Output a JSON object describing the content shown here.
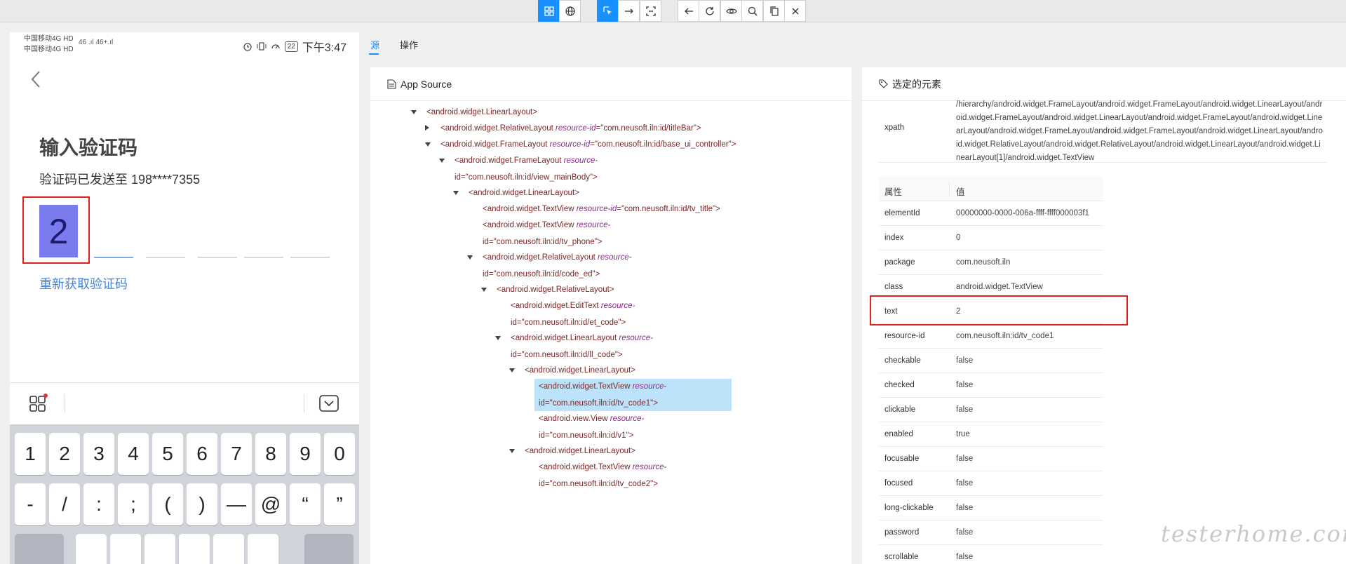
{
  "toolbar": {
    "buttons": [
      {
        "name": "native-app-mode-icon",
        "active": true
      },
      {
        "name": "web-mode-icon",
        "active": false
      },
      {
        "name": "select-elements-icon",
        "active": true
      },
      {
        "name": "swipe-by-coordinates-icon",
        "active": false
      },
      {
        "name": "tap-by-coordinates-icon",
        "active": false
      },
      {
        "name": "back-icon",
        "active": false
      },
      {
        "name": "refresh-icon",
        "active": false
      },
      {
        "name": "eye-icon",
        "active": false
      },
      {
        "name": "search-icon",
        "active": false
      },
      {
        "name": "copy-xml-icon",
        "active": false
      },
      {
        "name": "quit-session-icon",
        "active": false
      }
    ]
  },
  "device": {
    "status": {
      "carrier1": "中国移动4G HD",
      "carrier2": "中国移动4G HD",
      "signal": "46 .ıl 46+.ıl",
      "battery": "22",
      "time": "下午3:47"
    },
    "title": "输入验证码",
    "subtitle": "验证码已发送至 198****7355",
    "code_digit": "2",
    "resend": "重新获取验证码",
    "keyboard_row1": [
      "1",
      "2",
      "3",
      "4",
      "5",
      "6",
      "7",
      "8",
      "9",
      "0"
    ],
    "keyboard_row2": [
      "-",
      "/",
      ":",
      ";",
      "(",
      ")",
      "—",
      "@",
      "“",
      "”"
    ]
  },
  "tabs": [
    {
      "label": "源",
      "active": true
    },
    {
      "label": "操作",
      "active": false
    }
  ],
  "source": {
    "title": "App Source",
    "nodes": [
      {
        "indent": 0,
        "expand": "down",
        "tag": "<android.widget.LinearLayout>",
        "attr": "",
        "val": "",
        "line2": ""
      },
      {
        "indent": 1,
        "expand": "right",
        "tag": "<android.widget.RelativeLayout ",
        "attr": "resource-id",
        "val": "=\"com.neusoft.iln:id/titleBar\">",
        "line2": ""
      },
      {
        "indent": 1,
        "expand": "down",
        "tag": "<android.widget.FrameLayout ",
        "attr": "resource-id",
        "val": "=\"com.neusoft.iln:id/base_ui_controller\">",
        "line2": ""
      },
      {
        "indent": 2,
        "expand": "down",
        "tag": "<android.widget.FrameLayout ",
        "attr": "resource-",
        "val": "",
        "line2": "id=\"com.neusoft.iln:id/view_mainBody\">"
      },
      {
        "indent": 3,
        "expand": "down",
        "tag": "<android.widget.LinearLayout>",
        "attr": "",
        "val": "",
        "line2": ""
      },
      {
        "indent": 4,
        "expand": "",
        "tag": "<android.widget.TextView ",
        "attr": "resource-id",
        "val": "=\"com.neusoft.iln:id/tv_title\">",
        "line2": ""
      },
      {
        "indent": 4,
        "expand": "",
        "tag": "<android.widget.TextView ",
        "attr": "resource-",
        "val": "",
        "line2": "id=\"com.neusoft.iln:id/tv_phone\">"
      },
      {
        "indent": 4,
        "expand": "down",
        "tag": "<android.widget.RelativeLayout ",
        "attr": "resource-",
        "val": "",
        "line2": "id=\"com.neusoft.iln:id/code_ed\">"
      },
      {
        "indent": 5,
        "expand": "down",
        "tag": "<android.widget.RelativeLayout>",
        "attr": "",
        "val": "",
        "line2": ""
      },
      {
        "indent": 6,
        "expand": "",
        "tag": "<android.widget.EditText ",
        "attr": "resource-",
        "val": "",
        "line2": "id=\"com.neusoft.iln:id/et_code\">"
      },
      {
        "indent": 6,
        "expand": "down",
        "tag": "<android.widget.LinearLayout ",
        "attr": "resource-",
        "val": "",
        "line2": "id=\"com.neusoft.iln:id/ll_code\">"
      },
      {
        "indent": 7,
        "expand": "down",
        "tag": "<android.widget.LinearLayout>",
        "attr": "",
        "val": "",
        "line2": ""
      },
      {
        "indent": 8,
        "expand": "",
        "tag": "<android.widget.TextView ",
        "attr": "resource-",
        "val": "",
        "line2": "id=\"com.neusoft.iln:id/tv_code1\">",
        "selected": true
      },
      {
        "indent": 8,
        "expand": "",
        "tag": "<android.view.View ",
        "attr": "resource-",
        "val": "",
        "line2": "id=\"com.neusoft.iln:id/v1\">"
      },
      {
        "indent": 7,
        "expand": "down",
        "tag": "<android.widget.LinearLayout>",
        "attr": "",
        "val": "",
        "line2": ""
      },
      {
        "indent": 8,
        "expand": "",
        "tag": "<android.widget.TextView ",
        "attr": "resource-",
        "val": "",
        "line2": "id=\"com.neusoft.iln:id/tv_code2\">"
      }
    ]
  },
  "selected": {
    "title": "选定的元素",
    "xpath_label": "xpath",
    "xpath_value": "/hierarchy/android.widget.FrameLayout/android.widget.FrameLayout/android.widget.LinearLayout/android.widget.FrameLayout/android.widget.LinearLayout/android.widget.FrameLayout/android.widget.LinearLayout/android.widget.FrameLayout/android.widget.FrameLayout/android.widget.LinearLayout/android.widget.RelativeLayout/android.widget.RelativeLayout/android.widget.LinearLayout/android.widget.LinearLayout[1]/android.widget.TextView",
    "col_attr": "属性",
    "col_value": "值",
    "props": [
      {
        "k": "elementId",
        "v": "00000000-0000-006a-ffff-ffff000003f1"
      },
      {
        "k": "index",
        "v": "0"
      },
      {
        "k": "package",
        "v": "com.neusoft.iln"
      },
      {
        "k": "class",
        "v": "android.widget.TextView"
      },
      {
        "k": "text",
        "v": "2"
      },
      {
        "k": "resource-id",
        "v": "com.neusoft.iln:id/tv_code1"
      },
      {
        "k": "checkable",
        "v": "false"
      },
      {
        "k": "checked",
        "v": "false"
      },
      {
        "k": "clickable",
        "v": "false"
      },
      {
        "k": "enabled",
        "v": "true"
      },
      {
        "k": "focusable",
        "v": "false"
      },
      {
        "k": "focused",
        "v": "false"
      },
      {
        "k": "long-clickable",
        "v": "false"
      },
      {
        "k": "password",
        "v": "false"
      },
      {
        "k": "scrollable",
        "v": "false"
      }
    ]
  },
  "watermark": "testerhome.com",
  "colors": {
    "accent": "#1890ff",
    "highlight": "#e02020",
    "selected_node": "#bde3fb"
  }
}
